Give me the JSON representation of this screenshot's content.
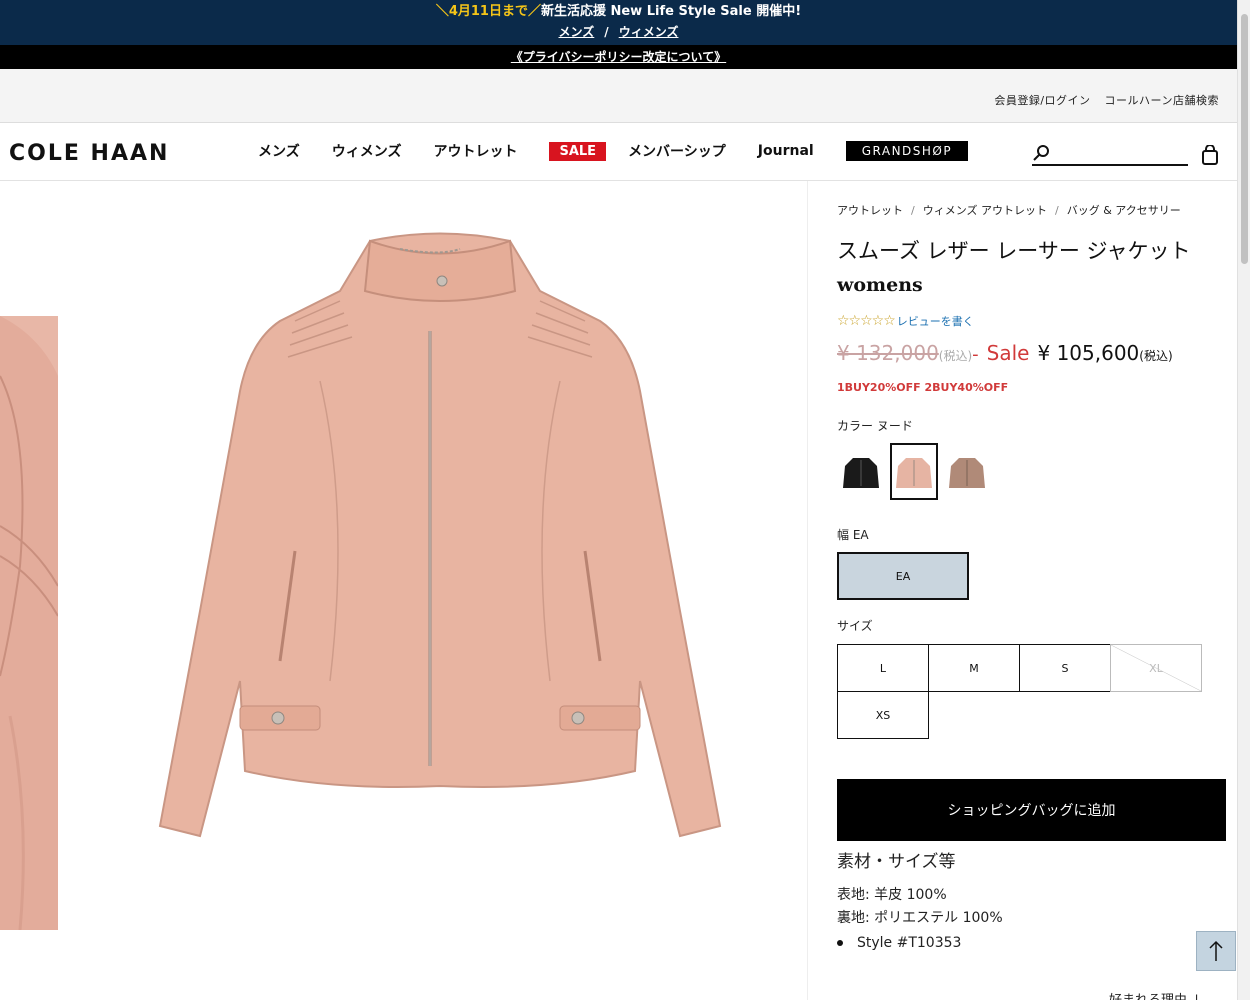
{
  "promo": {
    "date_text": "＼4月11日まで／",
    "main_text": "新生活応援 New Life Style Sale 開催中!",
    "link_mens": "メンズ",
    "link_sep": "/",
    "link_womens": "ウィメンズ"
  },
  "privacy": {
    "text": "《プライバシーポリシー改定について》"
  },
  "utility": {
    "login": "会員登録/ログイン",
    "store": "コールハーン店舗検索"
  },
  "header": {
    "logo": "COLE HAAN",
    "nav": {
      "mens": "メンズ",
      "womens": "ウィメンズ",
      "outlet": "アウトレット",
      "sale": "SALE",
      "membership": "メンバーシップ",
      "journal": "Journal",
      "grandshop": "GRANDSHØP"
    },
    "search_placeholder": ""
  },
  "product": {
    "breadcrumbs": [
      "アウトレット",
      "ウィメンズ アウトレット",
      "バッグ & アクセサリー"
    ],
    "breadcrumb_sep": "/",
    "title": "スムーズ レザー レーサー ジャケット",
    "gender": "womens",
    "stars": "☆☆☆☆☆",
    "review_link": "レビューを書く",
    "price_old": "¥ 132,000",
    "price_old_tax": "(税込)",
    "price_dash": "-",
    "sale_label": "Sale",
    "price_new": "¥ 105,600",
    "price_new_tax": "(税込)",
    "offer": "1BUY20%OFF 2BUY40%OFF",
    "color_label": "カラー ヌード",
    "width_label": "幅 EA",
    "width_value": "EA",
    "size_label": "サイズ",
    "sizes": [
      "L",
      "M",
      "S",
      "XL",
      "XS"
    ],
    "add_to_bag": "ショッピングバッグに追加",
    "spec_title": "素材・サイズ等",
    "spec_outer": "表地: 羊皮 100%",
    "spec_lining": "裏地: ポリエステル 100%",
    "spec_style": "Style #T10353",
    "why_loved": "好まれる理由 ↓"
  },
  "colors": {
    "swatch_black": "#1a1a1a",
    "swatch_nude": "#e6b4a3",
    "swatch_taupe": "#b08a78",
    "sale_red": "#d13a3a",
    "promo_navy": "#0b2a4a"
  }
}
